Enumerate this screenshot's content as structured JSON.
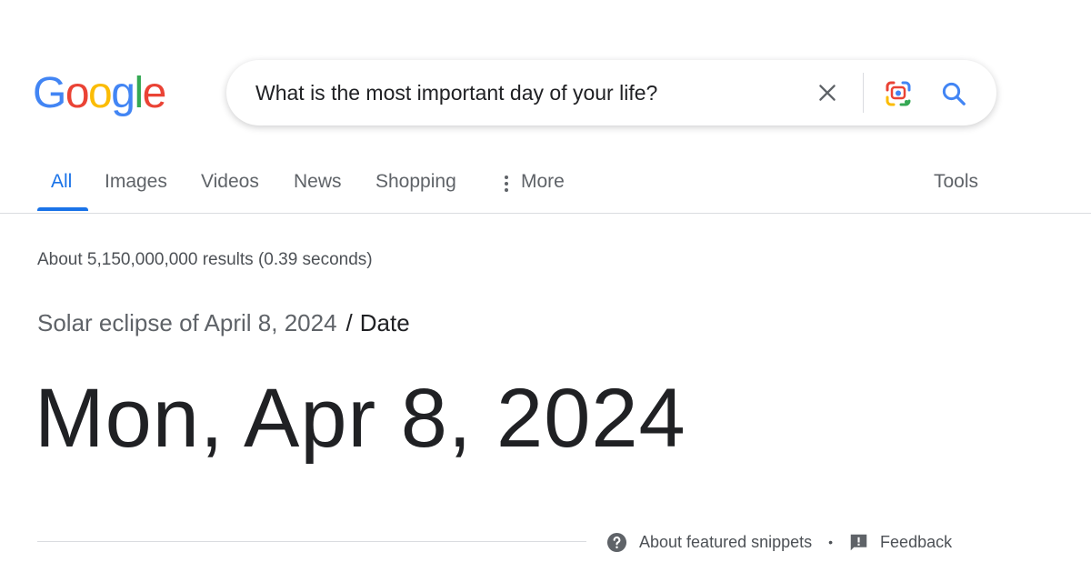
{
  "logo": {
    "text": [
      "G",
      "o",
      "o",
      "g",
      "l",
      "e"
    ],
    "colors": [
      "#4285f4",
      "#ea4335",
      "#fbbc05",
      "#4285f4",
      "#34a853",
      "#ea4335"
    ]
  },
  "search": {
    "query": "What is the most important day of your life?"
  },
  "icons": {
    "clear": "close-icon",
    "lens": "google-lens-icon",
    "search": "search-icon",
    "more": "more-vert-icon",
    "help": "help-circle-icon",
    "feedback": "feedback-icon"
  },
  "tabs": [
    {
      "label": "All",
      "active": true
    },
    {
      "label": "Images"
    },
    {
      "label": "Videos"
    },
    {
      "label": "News"
    },
    {
      "label": "Shopping"
    },
    {
      "label": "More"
    }
  ],
  "tools_label": "Tools",
  "result_stats": "About 5,150,000,000 results (0.39 seconds)",
  "answer_box": {
    "breadcrumb_topic": "Solar eclipse of April 8, 2024",
    "breadcrumb_separator": "/",
    "breadcrumb_attribute": "Date",
    "answer": "Mon, Apr 8, 2024"
  },
  "snippet_footer": {
    "about_label": "About featured snippets",
    "bullet": "•",
    "feedback_label": "Feedback"
  },
  "colors": {
    "accent": "#1a73e8",
    "text": "#202124",
    "muted": "#5f6368"
  }
}
